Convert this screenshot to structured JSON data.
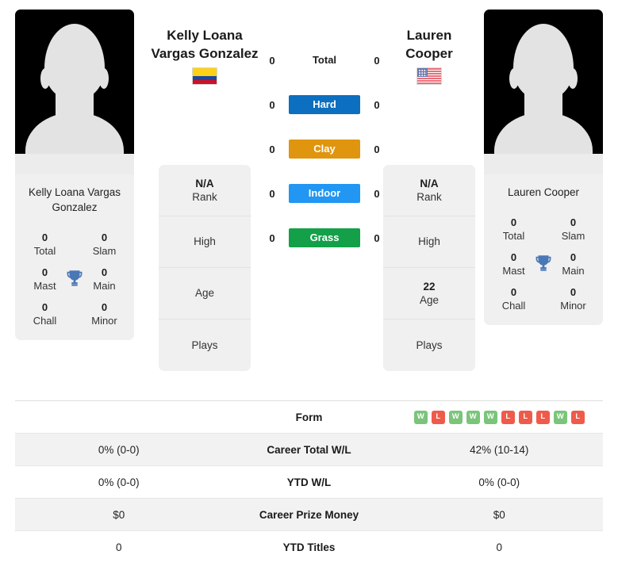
{
  "players": {
    "left": {
      "heading_line1": "Kelly Loana",
      "heading_line2": "Vargas Gonzalez",
      "flag": "colombia-flag",
      "card_name": "Kelly Loana Vargas Gonzalez",
      "titles": {
        "total_value": "0",
        "total_label": "Total",
        "slam_value": "0",
        "slam_label": "Slam",
        "mast_value": "0",
        "mast_label": "Mast",
        "main_value": "0",
        "main_label": "Main",
        "chall_value": "0",
        "chall_label": "Chall",
        "minor_value": "0",
        "minor_label": "Minor"
      },
      "info": [
        {
          "value": "N/A",
          "label": "Rank"
        },
        {
          "value": "",
          "label": "High"
        },
        {
          "value": "",
          "label": "Age"
        },
        {
          "value": "",
          "label": "Plays"
        }
      ],
      "surface_counts": {
        "total": "0",
        "hard": "0",
        "clay": "0",
        "indoor": "0",
        "grass": "0"
      }
    },
    "right": {
      "heading_line1": "Lauren",
      "heading_line2": "Cooper",
      "flag": "usa-flag",
      "card_name": "Lauren Cooper",
      "titles": {
        "total_value": "0",
        "total_label": "Total",
        "slam_value": "0",
        "slam_label": "Slam",
        "mast_value": "0",
        "mast_label": "Mast",
        "main_value": "0",
        "main_label": "Main",
        "chall_value": "0",
        "chall_label": "Chall",
        "minor_value": "0",
        "minor_label": "Minor"
      },
      "info": [
        {
          "value": "N/A",
          "label": "Rank"
        },
        {
          "value": "",
          "label": "High"
        },
        {
          "value": "22",
          "label": "Age"
        },
        {
          "value": "",
          "label": "Plays"
        }
      ],
      "surface_counts": {
        "total": "0",
        "hard": "0",
        "clay": "0",
        "indoor": "0",
        "grass": "0"
      }
    }
  },
  "surfaces": [
    {
      "key": "total",
      "label": "Total",
      "color": "transparent",
      "plain": true
    },
    {
      "key": "hard",
      "label": "Hard",
      "color": "#0c6fbf"
    },
    {
      "key": "clay",
      "label": "Clay",
      "color": "#e0950f"
    },
    {
      "key": "indoor",
      "label": "Indoor",
      "color": "#2196f3"
    },
    {
      "key": "grass",
      "label": "Grass",
      "color": "#13a049"
    }
  ],
  "table": {
    "rows": [
      {
        "label": "Form",
        "left": "",
        "right": "",
        "type": "form"
      },
      {
        "label": "Career Total W/L",
        "left": "0% (0-0)",
        "right": "42% (10-14)",
        "type": "text"
      },
      {
        "label": "YTD W/L",
        "left": "0% (0-0)",
        "right": "0% (0-0)",
        "type": "text"
      },
      {
        "label": "Career Prize Money",
        "left": "$0",
        "right": "$0",
        "type": "text"
      },
      {
        "label": "YTD Titles",
        "left": "0",
        "right": "0",
        "type": "text"
      }
    ],
    "form_right": [
      "W",
      "L",
      "W",
      "W",
      "W",
      "L",
      "L",
      "L",
      "W",
      "L"
    ],
    "form_left": []
  },
  "colors": {
    "hard": "#0c6fbf",
    "clay": "#e0950f",
    "indoor": "#2196f3",
    "grass": "#13a049",
    "win": "#7ac57a",
    "loss": "#ef5b4a",
    "trophy": "#4a77b5",
    "card_bg": "#f0f0f0",
    "stripe_bg": "#f2f2f2"
  },
  "icons": {
    "trophy": "trophy-icon",
    "avatar": "avatar-placeholder-icon"
  }
}
